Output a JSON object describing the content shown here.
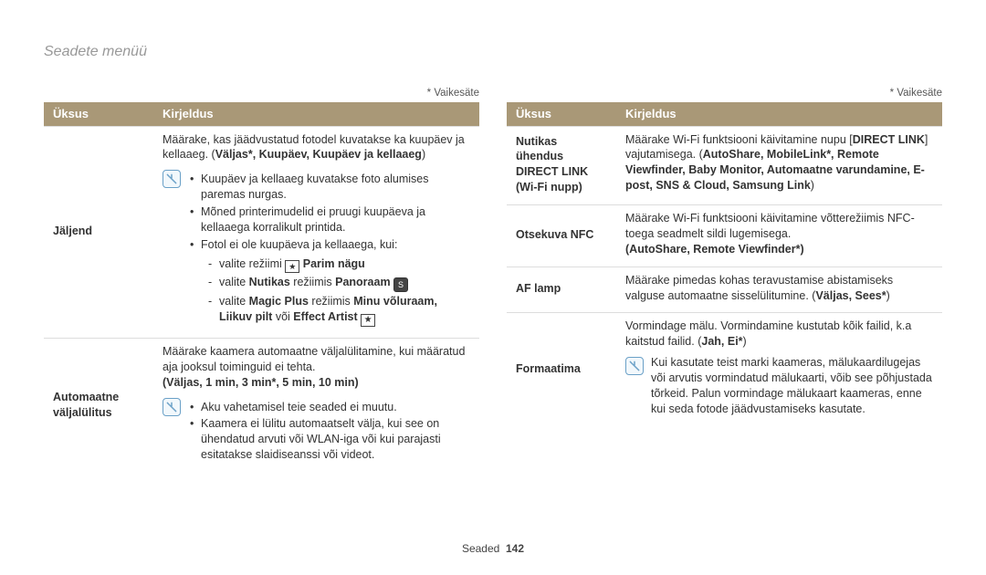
{
  "page": {
    "title": "Seadete menüü",
    "default_note": "* Vaikesäte"
  },
  "headers": {
    "item": "Üksus",
    "desc": "Kirjeldus"
  },
  "footer": {
    "section": "Seaded",
    "page": "142"
  },
  "left": {
    "rows": [
      {
        "label": "Jäljend",
        "intro1": "Määrake, kas jäädvustatud fotodel kuvatakse ka kuupäev ja kellaaeg. (",
        "intro_bold": "Väljas*, Kuupäev, Kuupäev ja kellaaeg",
        "intro2": ")",
        "bullets": [
          "Kuupäev ja kellaaeg kuvatakse foto alumises paremas nurgas.",
          "Mõned printerimudelid ei pruugi kuupäeva ja kellaaega korralikult printida.",
          "Fotol ei ole kuupäeva ja kellaaega, kui:"
        ],
        "dash1_pre": "valite režiimi ",
        "dash1_bold": "Parim nägu",
        "dash2_pre": "valite ",
        "dash2_b1": "Nutikas",
        "dash2_mid": " režiimis ",
        "dash2_b2": "Panoraam ",
        "dash3_pre": "valite ",
        "dash3_b1": "Magic Plus",
        "dash3_mid": " režiimis ",
        "dash3_b2": "Minu võluraam, Liikuv pilt",
        "dash3_post": " või ",
        "dash3_b3": "Effect Artist "
      },
      {
        "label": "Automaatne väljalülitus",
        "para": "Määrake kaamera automaatne väljalülitamine, kui määratud aja jooksul toiminguid ei tehta.",
        "options": "(Väljas, 1 min, 3 min*, 5 min, 10 min)",
        "b1": "Aku vahetamisel teie seaded ei muutu.",
        "b2": "Kaamera ei lülitu automaatselt välja, kui see on ühendatud arvuti või WLAN-iga või kui parajasti esitatakse slaidiseanssi või videot."
      }
    ]
  },
  "right": {
    "rows": [
      {
        "label": "Nutikas ühendus DIRECT LINK (Wi-Fi nupp)",
        "p1": "Määrake Wi-Fi funktsiooni käivitamine nupu [",
        "p1b": "DIRECT LINK",
        "p1c": "] vajutamisega. (",
        "p1bold": "AutoShare, MobileLink*, Remote Viewfinder, Baby Monitor, Automaatne varundamine, E-post, SNS & Cloud, Samsung Link",
        "p1end": ")"
      },
      {
        "label": "Otsekuva NFC",
        "p": "Määrake Wi-Fi funktsiooni käivitamine võtterežiimis NFC-toega seadmelt sildi lugemisega.",
        "opt": "(AutoShare, Remote Viewfinder*)"
      },
      {
        "label": "AF lamp",
        "p1": "Määrake pimedas kohas teravustamise abistamiseks valguse automaatne sisselülitumine. (",
        "p1b": "Väljas, Sees*",
        "p1end": ")"
      },
      {
        "label": "Formaatima",
        "p1": "Vormindage mälu. Vormindamine kustutab kõik failid, k.a kaitstud failid. (",
        "p1b": "Jah, Ei*",
        "p1end": ")",
        "note": "Kui kasutate teist marki kaameras, mälukaardilugejas või arvutis vormindatud mälukaarti, võib see põhjustada tõrkeid. Palun vormindage mälukaart kaameras, enne kui seda fotode jäädvustamiseks kasutate."
      }
    ]
  }
}
